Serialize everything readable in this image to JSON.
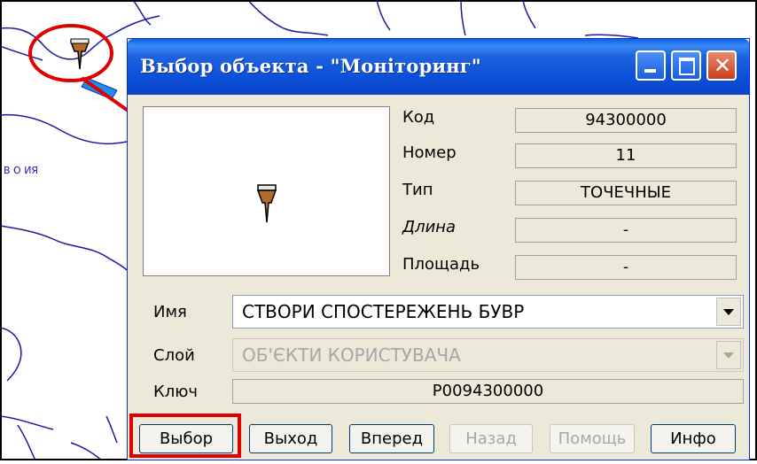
{
  "dialog": {
    "title": "Выбор объекта - \"Моніторинг\"",
    "window_buttons": [
      "minimize-icon",
      "maximize-icon",
      "close-icon"
    ]
  },
  "properties": [
    {
      "label": "Код",
      "value": "94300000"
    },
    {
      "label": "Номер",
      "value": "11"
    },
    {
      "label": "Тип",
      "value": "ТОЧЕЧНЫЕ"
    },
    {
      "label": "Длина",
      "value": "-"
    },
    {
      "label": "Площадь",
      "value": "-"
    }
  ],
  "fields": {
    "name_label": "Имя",
    "name_value": "СТВОРИ СПОСТЕРЕЖЕНЬ БУВР",
    "layer_label": "Слой",
    "layer_value": "ОБ'ЄКТИ КОРИСТУВАЧА",
    "key_label": "Ключ",
    "key_value": "P0094300000"
  },
  "buttons": {
    "select": "Выбор",
    "exit": "Выход",
    "forward": "Вперед",
    "back": "Назад",
    "help": "Помощь",
    "info": "Инфо"
  },
  "map": {
    "label": "В О ИЯ"
  },
  "colors": {
    "annotation": "#e00000",
    "river": "#1a1aa0",
    "titlebar": "#0a4fd8"
  }
}
